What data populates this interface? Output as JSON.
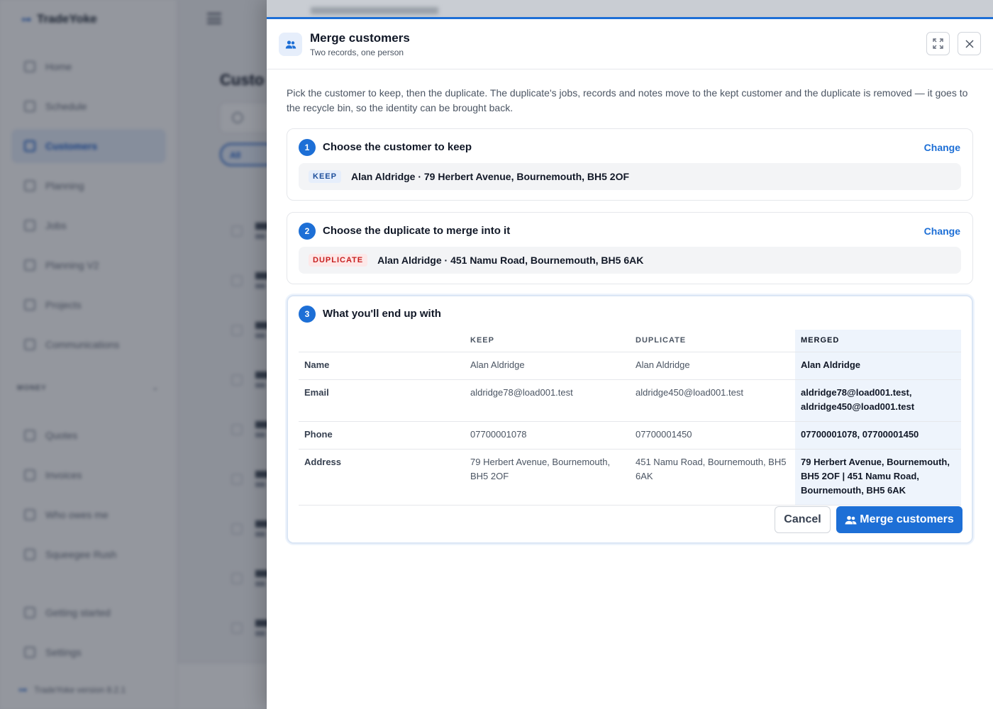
{
  "app": {
    "logo_text": "TradeYoke",
    "version_text": "TradeYoke version 8.2.1",
    "page_title": "Custo",
    "filter_all": "All",
    "nav": [
      {
        "label": "Home",
        "icon": "home-icon"
      },
      {
        "label": "Schedule",
        "icon": "calendar-icon"
      },
      {
        "label": "Customers",
        "icon": "users-icon",
        "active": true
      },
      {
        "label": "Planning",
        "icon": "planning-icon"
      },
      {
        "label": "Jobs",
        "icon": "clipboard-icon"
      },
      {
        "label": "Planning V2",
        "icon": "planning-v2-icon"
      },
      {
        "label": "Projects",
        "icon": "projects-icon"
      },
      {
        "label": "Communications",
        "icon": "chat-icon"
      }
    ],
    "money_section": "MONEY",
    "nav_money": [
      {
        "label": "Quotes",
        "icon": "quote-icon"
      },
      {
        "label": "Invoices",
        "icon": "invoice-icon"
      },
      {
        "label": "Who owes me",
        "icon": "owes-icon"
      },
      {
        "label": "Squeegee Rush",
        "icon": "squeegee-icon"
      }
    ],
    "nav_bottom": [
      {
        "label": "Getting started",
        "icon": "rocket-icon"
      },
      {
        "label": "Settings",
        "icon": "gear-icon"
      }
    ]
  },
  "drawer": {
    "title": "Merge customers",
    "subtitle": "Two records, one person",
    "intro": "Pick the customer to keep, then the duplicate. The duplicate's jobs, records and notes move to the kept customer and the duplicate is removed — it goes to the recycle bin, so the identity can be brought back.",
    "step1": {
      "number": "1",
      "title": "Choose the customer to keep",
      "change": "Change",
      "tag": "KEEP",
      "selection": "Alan Aldridge · 79 Herbert Avenue, Bournemouth, BH5 2OF"
    },
    "step2": {
      "number": "2",
      "title": "Choose the duplicate to merge into it",
      "change": "Change",
      "tag": "DUPLICATE",
      "selection": "Alan Aldridge · 451 Namu Road, Bournemouth, BH5 6AK"
    },
    "step3": {
      "number": "3",
      "title": "What you'll end up with",
      "headers": {
        "keep": "KEEP",
        "duplicate": "DUPLICATE",
        "merged": "MERGED"
      },
      "rows": [
        {
          "label": "Name",
          "keep": "Alan Aldridge",
          "duplicate": "Alan Aldridge",
          "merged": "Alan Aldridge"
        },
        {
          "label": "Email",
          "keep": "aldridge78@load001.test",
          "duplicate": "aldridge450@load001.test",
          "merged": "aldridge78@load001.test, aldridge450@load001.test"
        },
        {
          "label": "Phone",
          "keep": "07700001078",
          "duplicate": "07700001450",
          "merged": "07700001078, 07700001450"
        },
        {
          "label": "Address",
          "keep": "79 Herbert Avenue, Bournemouth, BH5 2OF",
          "duplicate": "451 Namu Road, Bournemouth, BH5 6AK",
          "merged": "79 Herbert Avenue, Bournemouth, BH5 2OF | 451 Namu Road, Bournemouth, BH5 6AK"
        }
      ]
    },
    "actions": {
      "cancel": "Cancel",
      "merge": "Merge customers"
    },
    "colors": {
      "accent": "#1d6fd6",
      "keep_tag": "#1d4f9c",
      "duplicate_tag": "#c81e1e",
      "merged_bg": "#eef4fc"
    }
  }
}
